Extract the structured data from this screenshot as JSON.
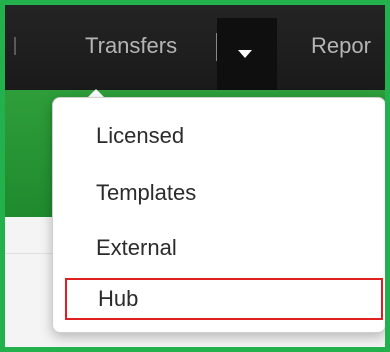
{
  "navbar": {
    "transfers_label": "Transfers",
    "reports_label": "Repor"
  },
  "transfers_menu": {
    "items": [
      {
        "label": "Licensed"
      },
      {
        "label": "Templates"
      },
      {
        "label": "External"
      },
      {
        "label": "Hub",
        "highlighted": true
      }
    ]
  },
  "colors": {
    "frame_border": "#22b14c",
    "navbar_bg": "#1f1f1f",
    "green_band": "#2e9e3a",
    "highlight_border": "#e02020"
  },
  "icons": {
    "dropdown_toggle": "caret-down-icon"
  }
}
